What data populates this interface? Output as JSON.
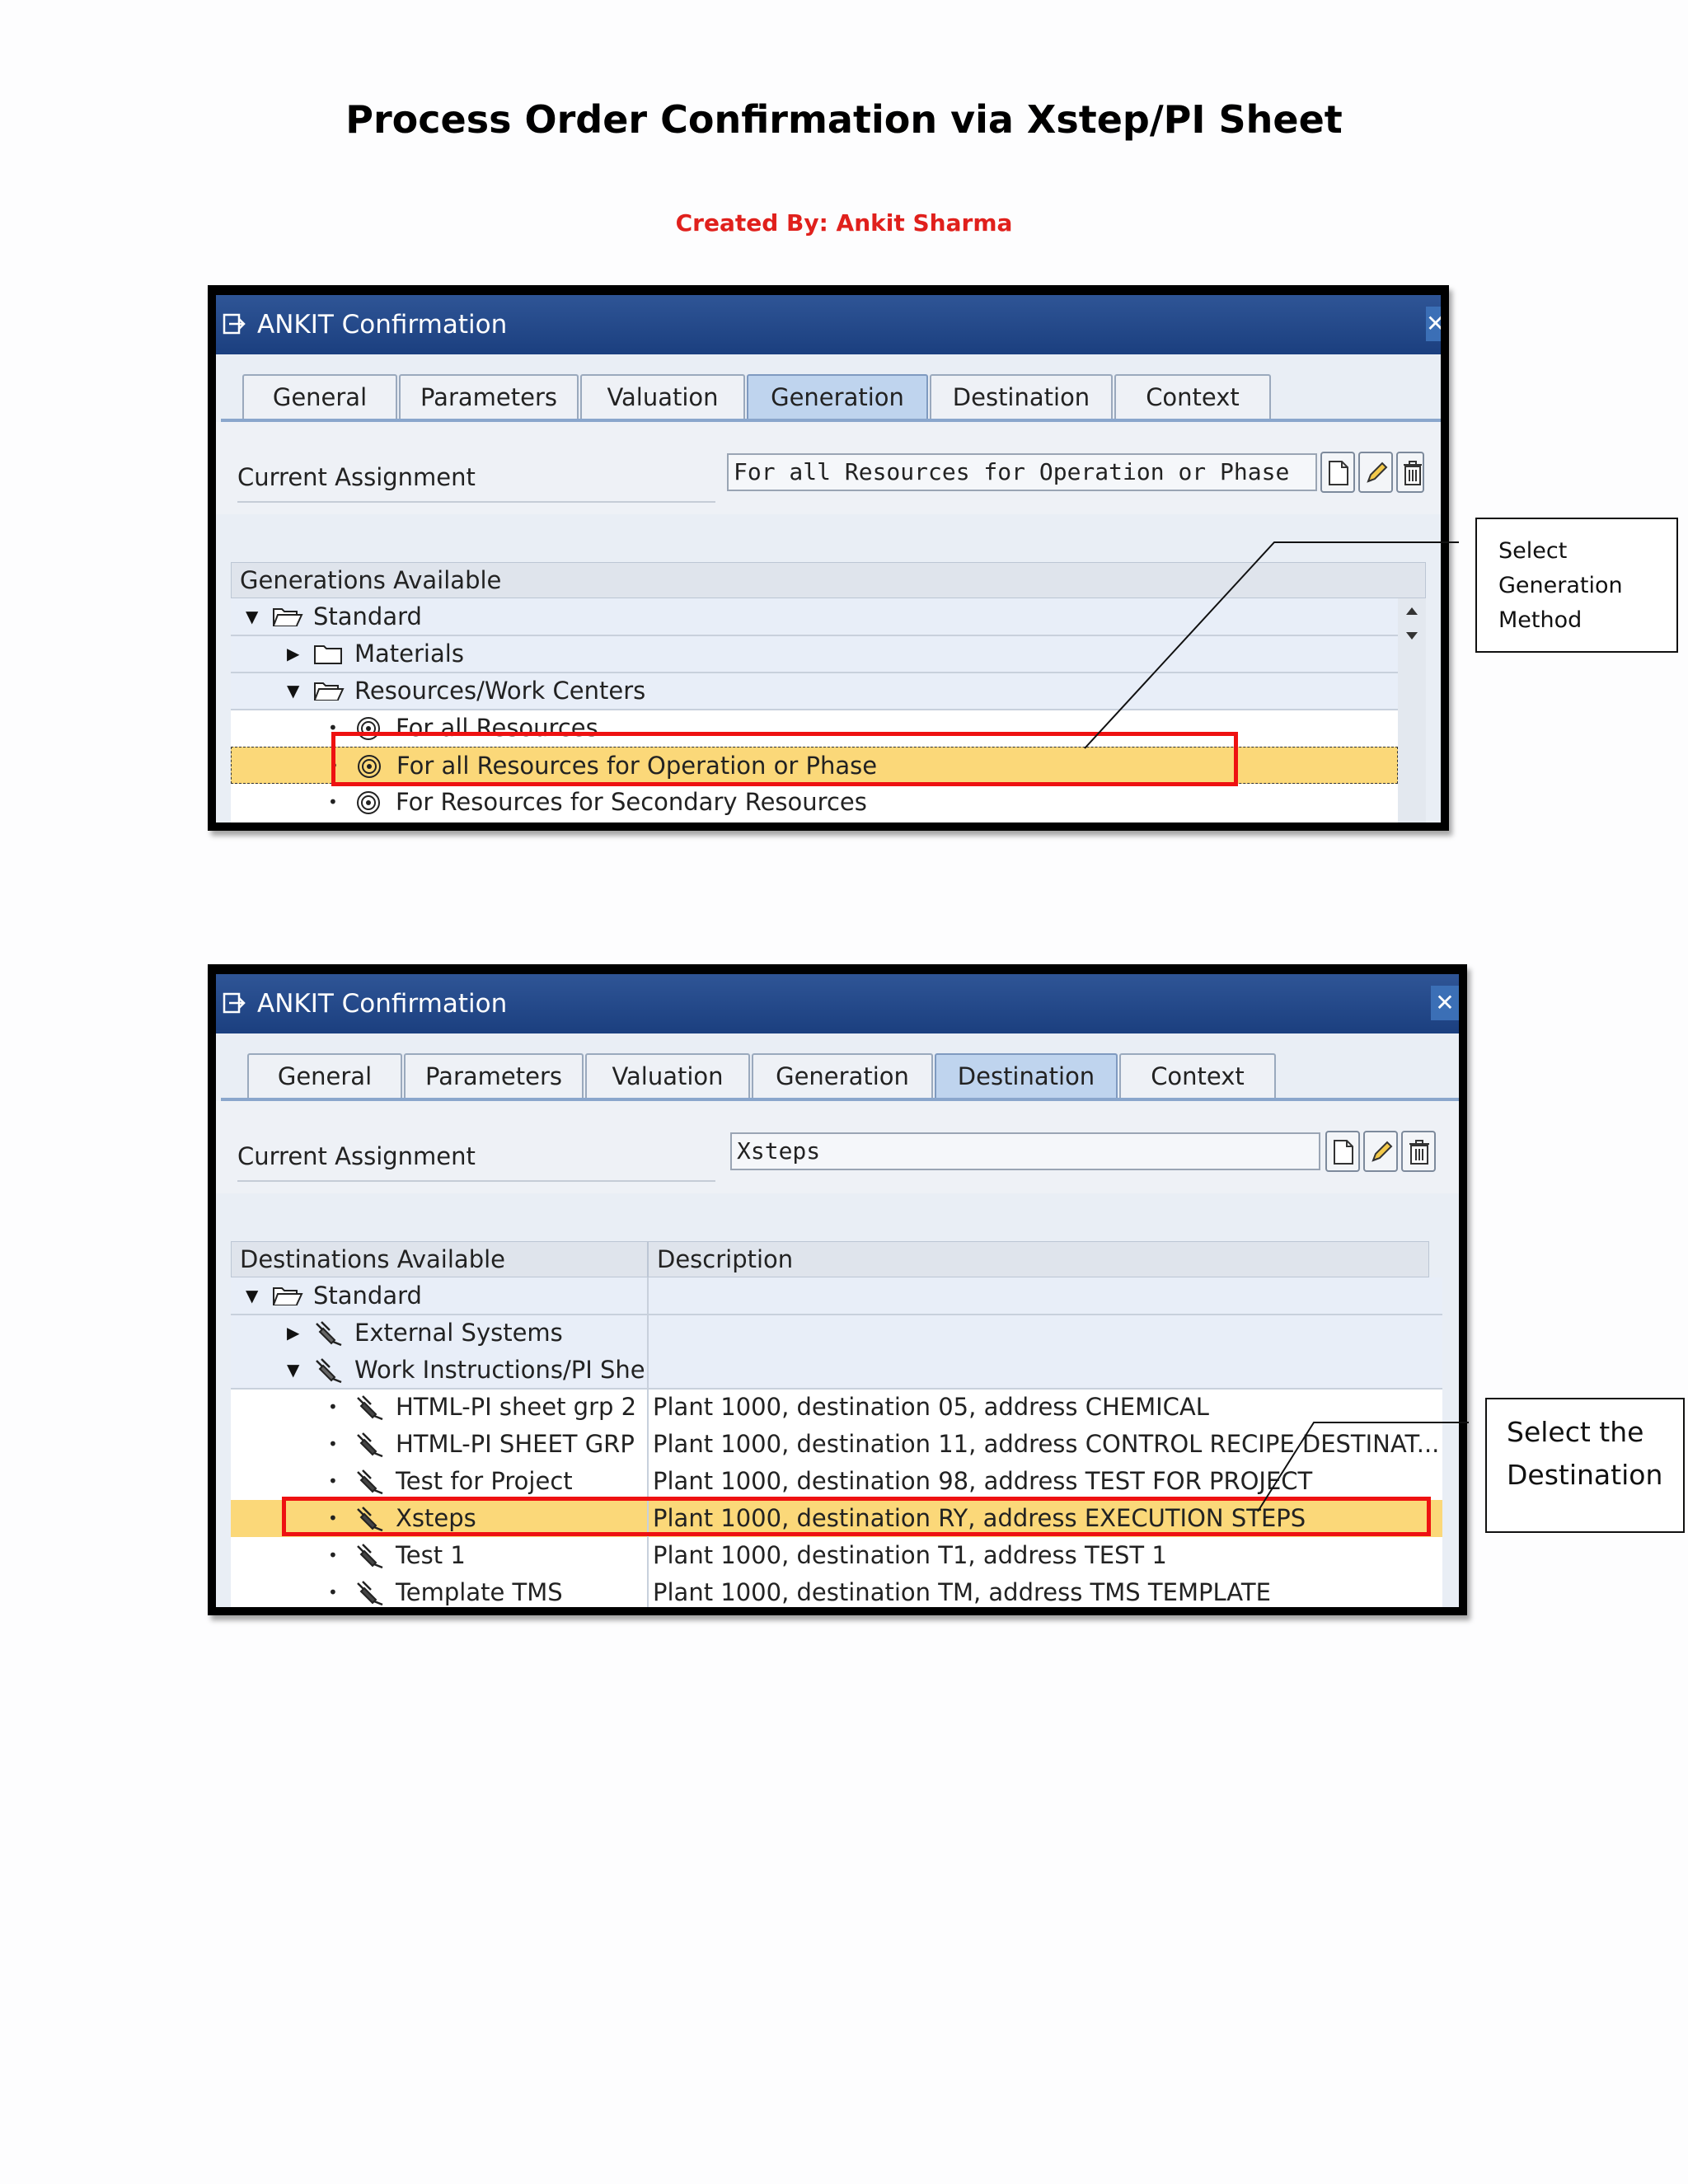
{
  "document": {
    "title": "Process Order Confirmation via Xstep/PI Sheet",
    "author": "Created By: Ankit Sharma"
  },
  "screenshot1": {
    "window_title": "ANKIT Confirmation",
    "tabs": [
      "General",
      "Parameters",
      "Valuation",
      "Generation",
      "Destination",
      "Context"
    ],
    "active_tab": "Generation",
    "current_assignment_label": "Current Assignment",
    "current_assignment_value": "For all Resources for Operation or Phase",
    "tree_header": "Generations Available",
    "tree": [
      {
        "label": "Standard",
        "icon": "folder-open-icon"
      },
      {
        "label": "Materials",
        "icon": "folder-icon"
      },
      {
        "label": "Resources/Work Centers",
        "icon": "folder-open-icon"
      },
      {
        "label": "For all Resources",
        "icon": "spiral-icon"
      },
      {
        "label": "For all Resources for Operation or Phase",
        "icon": "spiral-icon",
        "selected": true
      },
      {
        "label": "For Resources for Secondary Resources",
        "icon": "spiral-icon"
      }
    ],
    "callout": [
      "Select",
      "Generation",
      "Method"
    ]
  },
  "screenshot2": {
    "window_title": "ANKIT Confirmation",
    "tabs": [
      "General",
      "Parameters",
      "Valuation",
      "Generation",
      "Destination",
      "Context"
    ],
    "active_tab": "Destination",
    "current_assignment_label": "Current Assignment",
    "current_assignment_value": "Xsteps",
    "columns": [
      "Destinations Available",
      "Description"
    ],
    "tree": [
      {
        "label": "Standard",
        "description": ""
      },
      {
        "label": "External Systems",
        "description": ""
      },
      {
        "label": "Work Instructions/PI She",
        "description": ""
      },
      {
        "label": "HTML-PI sheet grp 2",
        "description": "Plant 1000, destination 05, address CHEMICAL"
      },
      {
        "label": "HTML-PI SHEET GRP",
        "description": "Plant 1000, destination 11, address CONTROL RECIPE DESTINAT..."
      },
      {
        "label": "Test for Project",
        "description": "Plant 1000, destination 98, address TEST FOR PROJECT"
      },
      {
        "label": "Xsteps",
        "description": "Plant 1000, destination RY, address EXECUTION STEPS",
        "selected": true
      },
      {
        "label": "Test 1",
        "description": "Plant 1000, destination T1, address TEST 1"
      },
      {
        "label": "Template TMS",
        "description": "Plant 1000, destination TM, address TMS TEMPLATE"
      }
    ],
    "callout": [
      "Select the",
      "Destination"
    ]
  },
  "colors": {
    "title_bar": "#1b3f7f",
    "active_tab": "#bfd4ee",
    "selection": "#fbd879",
    "highlight_box": "#ee1111",
    "author_text": "#e0201c"
  }
}
